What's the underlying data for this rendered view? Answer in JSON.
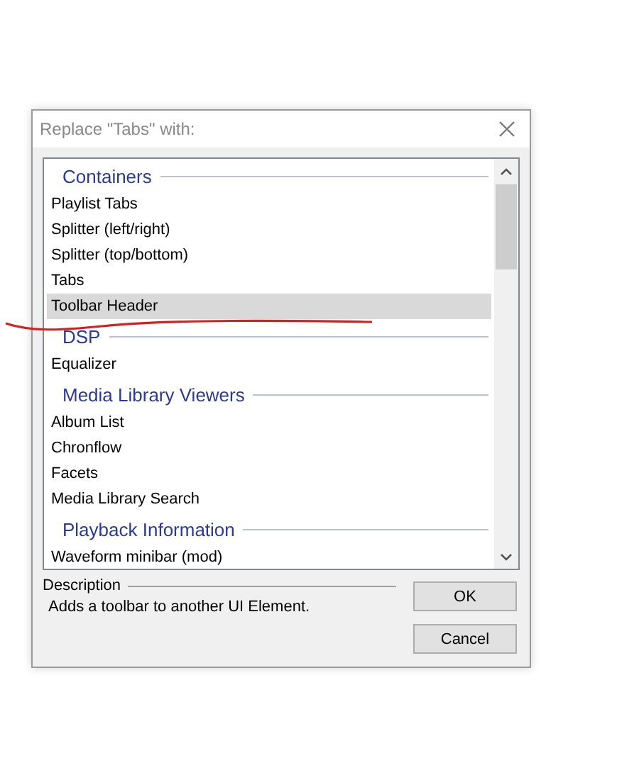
{
  "window": {
    "title": "Replace \"Tabs\" with:"
  },
  "groups": [
    {
      "title": "Containers",
      "items": [
        {
          "label": "Playlist Tabs",
          "selected": false
        },
        {
          "label": "Splitter (left/right)",
          "selected": false
        },
        {
          "label": "Splitter (top/bottom)",
          "selected": false
        },
        {
          "label": "Tabs",
          "selected": false
        },
        {
          "label": "Toolbar Header",
          "selected": true
        }
      ]
    },
    {
      "title": "DSP",
      "items": [
        {
          "label": "Equalizer",
          "selected": false
        }
      ]
    },
    {
      "title": "Media Library Viewers",
      "items": [
        {
          "label": "Album List",
          "selected": false
        },
        {
          "label": "Chronflow",
          "selected": false
        },
        {
          "label": "Facets",
          "selected": false
        },
        {
          "label": "Media Library Search",
          "selected": false
        }
      ]
    },
    {
      "title": "Playback Information",
      "items": [
        {
          "label": "Waveform minibar (mod)",
          "selected": false
        }
      ]
    }
  ],
  "description": {
    "title": "Description",
    "text": "Adds a toolbar to another UI Element."
  },
  "buttons": [
    "OK",
    "Cancel"
  ]
}
